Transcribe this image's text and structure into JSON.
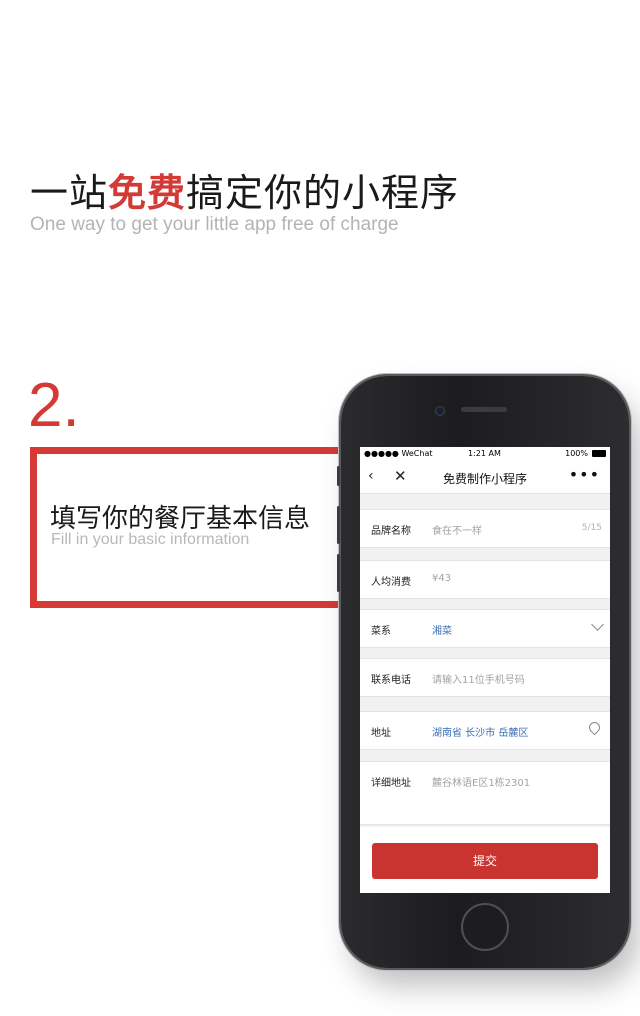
{
  "headline": {
    "before": "一站",
    "highlight": "免费",
    "after": "搞定你的小程序"
  },
  "subhead": "One way to get your little app free of charge",
  "step_number": "2.",
  "box": {
    "title": "填写你的餐厅基本信息",
    "subtitle": "Fill in your basic information"
  },
  "phone": {
    "status": {
      "carrier": "●●●●● WeChat",
      "time": "1:21 AM",
      "battery": "100%"
    },
    "nav": {
      "back": "‹",
      "close": "✕",
      "title": "免费制作小程序",
      "more": "•••"
    },
    "form": {
      "brand": {
        "label": "品牌名称",
        "placeholder": "食在不一样",
        "counter": "5/15"
      },
      "spend": {
        "label": "人均消费",
        "placeholder": "¥43"
      },
      "cuisine": {
        "label": "菜系",
        "value": "湘菜"
      },
      "phone": {
        "label": "联系电话",
        "placeholder": "请输入11位手机号码"
      },
      "address": {
        "label": "地址",
        "value": "湖南省 长沙市 岳麓区"
      },
      "detail": {
        "label": "详细地址",
        "placeholder": "麓谷林语E区1栋2301"
      }
    },
    "submit_label": "提交"
  },
  "colors": {
    "accent": "#d43a35",
    "link_blue": "#3a6fb5",
    "button_red": "#c93431"
  }
}
